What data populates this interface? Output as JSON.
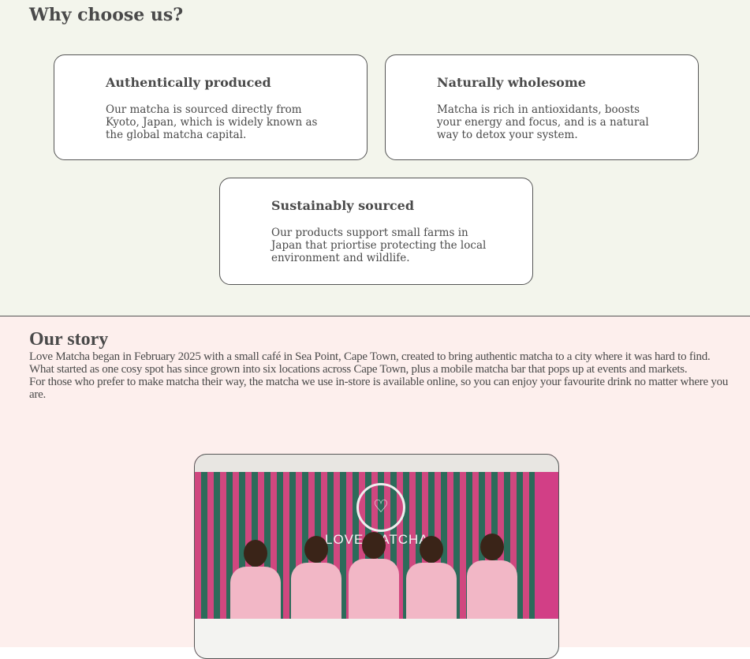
{
  "why": {
    "title": "Why choose us?",
    "cards": [
      {
        "title": "Authentically produced",
        "text": "Our matcha is sourced directly from Kyoto, Japan, which is widely known as the global matcha capital."
      },
      {
        "title": "Naturally wholesome",
        "text": "Matcha is rich in antioxidants, boosts your energy and focus, and is a natural way to detox your system."
      },
      {
        "title": "Sustainably sourced",
        "text": "Our products support small farms in Japan that priortise protecting the local environment and wildlife."
      }
    ]
  },
  "story": {
    "title": "Our story",
    "paragraphs": [
      "Love Matcha began in February 2025 with a small café in Sea Point, Cape Town, created to bring authentic matcha to a city where it was hard to find.",
      "What started as one cosy spot has since grown into six locations across Cape Town, plus a mobile matcha bar that pops up at events and markets.",
      "For those who prefer to make matcha their way, the matcha we use in-store is available online, so you can enjoy your favourite drink no matter where you are."
    ],
    "photo": {
      "sign_text": "LOVE MATCHA",
      "colors": {
        "pink": "#d0477f",
        "green": "#2c6b5a"
      }
    }
  }
}
